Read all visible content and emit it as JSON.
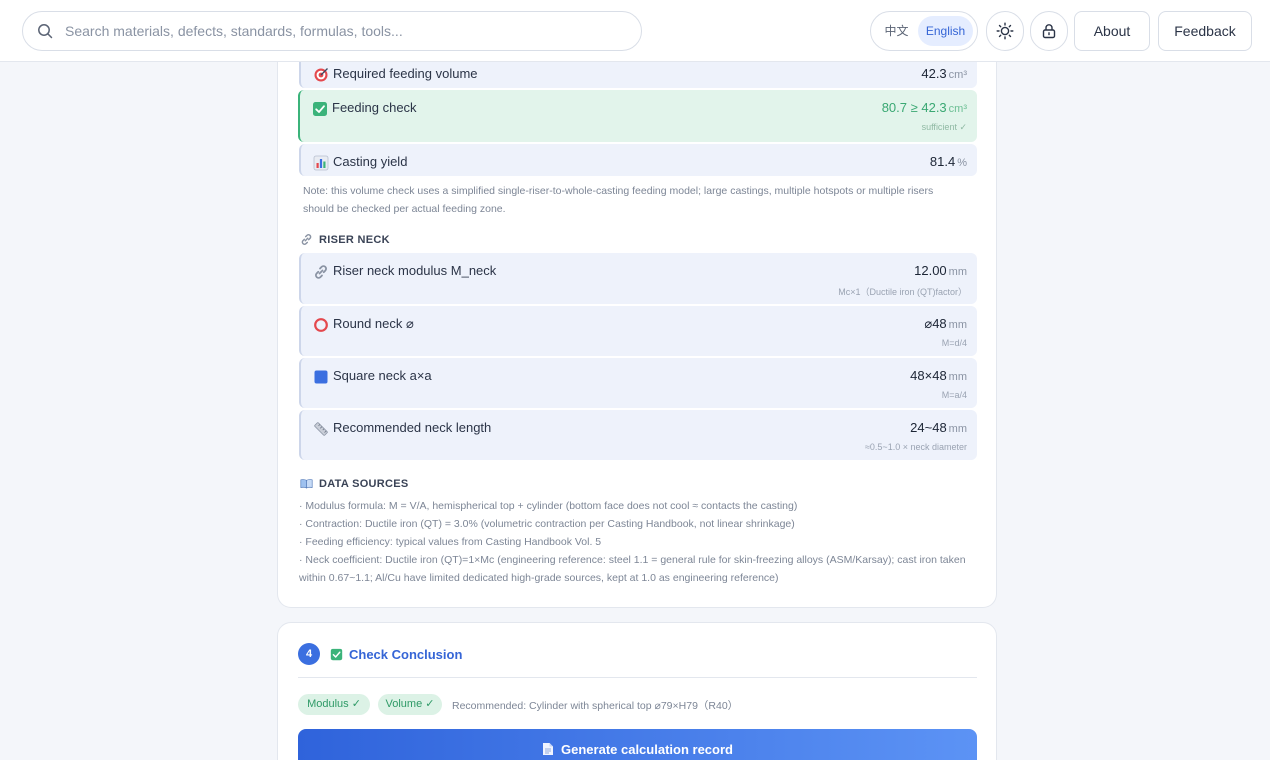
{
  "header": {
    "search_placeholder": "Search materials, defects, standards, formulas, tools...",
    "lang_zh": "中文",
    "lang_en": "English",
    "about": "About",
    "feedback": "Feedback"
  },
  "feeding": {
    "required": {
      "icon": "target-icon",
      "label": "Required feeding volume",
      "value": "42.3",
      "unit": "cm³"
    },
    "check": {
      "icon": "check-box-icon",
      "label": "Feeding check",
      "value": "80.7 ≥ 42.3",
      "unit": "cm³",
      "sub": "sufficient ✓"
    },
    "yield": {
      "icon": "bar-chart-icon",
      "label": "Casting yield",
      "value": "81.4",
      "unit": "%"
    },
    "note_line1": "Note: this volume check uses a simplified single-riser-to-whole-casting feeding model; large castings, multiple hotspots or multiple risers",
    "note_line2": "should be checked per actual feeding zone."
  },
  "riser_neck": {
    "heading": "RISER NECK",
    "rows": [
      {
        "icon": "link-icon",
        "label": "Riser neck modulus M_neck",
        "value": "12.00",
        "unit": "mm",
        "sub": "Mc×1（Ductile iron (QT)factor）"
      },
      {
        "icon": "circle-icon",
        "label": "Round neck ⌀",
        "value": "⌀48",
        "unit": "mm",
        "sub": "M=d/4"
      },
      {
        "icon": "square-icon",
        "label": "Square neck a×a",
        "value": "48×48",
        "unit": "mm",
        "sub": "M=a/4"
      },
      {
        "icon": "ruler-icon",
        "label": "Recommended neck length",
        "value": "24~48",
        "unit": "mm",
        "sub": "≈0.5~1.0 × neck diameter"
      }
    ]
  },
  "sources": {
    "heading": "DATA SOURCES",
    "line1": "· Modulus formula: M = V/A, hemispherical top + cylinder (bottom face does not cool ≈ contacts the casting)",
    "line2": "· Contraction: Ductile iron (QT) = 3.0% (volumetric contraction per Casting Handbook, not linear shrinkage)",
    "line3": "· Feeding efficiency: typical values from Casting Handbook Vol. 5",
    "line4": "· Neck coefficient: Ductile iron (QT)=1×Mc (engineering reference: steel 1.1 = general rule for skin-freezing alloys (ASM/Karsay); cast iron taken",
    "line5": "within 0.67~1.1; Al/Cu have limited dedicated high-grade sources, kept at 1.0 as engineering reference)"
  },
  "conclusion": {
    "step": "4",
    "title": "Check Conclusion",
    "badge_modulus": "Modulus ✓",
    "badge_volume": "Volume ✓",
    "recommendation": "Recommended: Cylinder with spherical top ⌀79×H79（R40）",
    "generate_button": "Generate calculation record"
  },
  "colors": {
    "accent": "#3565d6",
    "success": "#3bb37a",
    "row_bg": "#eef2fb"
  }
}
